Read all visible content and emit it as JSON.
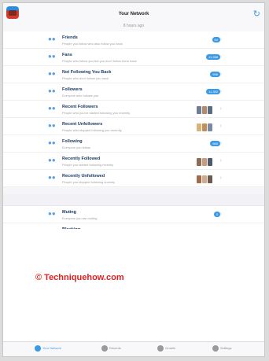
{
  "header": {
    "title": "Your Network",
    "subtitle": "8 hours ago",
    "refresh_icon": "refresh-icon"
  },
  "rows": [
    {
      "key": "friends",
      "icon": "friends-icon",
      "label": "Friends",
      "desc": "People you follow who also follow you back",
      "badge": "64"
    },
    {
      "key": "fans",
      "icon": "fans-icon",
      "label": "Fans",
      "desc": "People who follow you but you don't follow them back",
      "badge": "11,288"
    },
    {
      "key": "not-following-back",
      "icon": "not-following-back-icon",
      "label": "Not Following You Back",
      "desc": "People who don't follow you back",
      "badge": "596"
    },
    {
      "key": "followers",
      "icon": "followers-icon",
      "label": "Followers",
      "desc": "Everyone who follows you",
      "badge": "11,352"
    },
    {
      "key": "recent-followers",
      "icon": "recent-followers-icon",
      "label": "Recent Followers",
      "desc": "People who you've started following you recently",
      "avatars": [
        "#6e7e96",
        "#b48a6e",
        "#5c6c7c"
      ]
    },
    {
      "key": "recent-unfollowers",
      "icon": "recent-unfollowers-icon",
      "label": "Recent Unfollowers",
      "desc": "People who stopped following you recently",
      "avatars": [
        "#d8b47a",
        "#c48e5c",
        "#7a8aa0"
      ]
    },
    {
      "key": "following",
      "icon": "following-icon",
      "label": "Following",
      "desc": "Everyone you follow",
      "badge": "660"
    },
    {
      "key": "recently-followed",
      "icon": "recently-followed-icon",
      "label": "Recently Followed",
      "desc": "People you started following recently",
      "avatars": [
        "#8a6e5a",
        "#c89c7c",
        "#4c5a6a"
      ]
    },
    {
      "key": "recently-unfollowed",
      "icon": "recently-unfollowed-icon",
      "label": "Recently Unfollowed",
      "desc": "People you stopped following recently",
      "avatars": [
        "#a06c4c",
        "#d4aa88",
        "#6a5a50"
      ]
    }
  ],
  "rows2": [
    {
      "key": "muting",
      "icon": "muting-icon",
      "label": "Muting",
      "desc": "Everyone you are muting",
      "badge": "0"
    },
    {
      "key": "blocking",
      "icon": "blocking-icon",
      "label": "Blocking",
      "desc": "Everyone you are blocking",
      "badge": "0"
    }
  ],
  "watermark": "© Techniquehow.com",
  "tabs": [
    {
      "key": "your-network",
      "label": "Your Network",
      "active": true
    },
    {
      "key": "recents",
      "label": "Recents",
      "active": false
    },
    {
      "key": "growth",
      "label": "Growth",
      "active": false
    },
    {
      "key": "settings",
      "label": "Settings",
      "active": false
    }
  ],
  "colors": {
    "accent": "#3a9ae6",
    "watermark": "#e02020"
  }
}
